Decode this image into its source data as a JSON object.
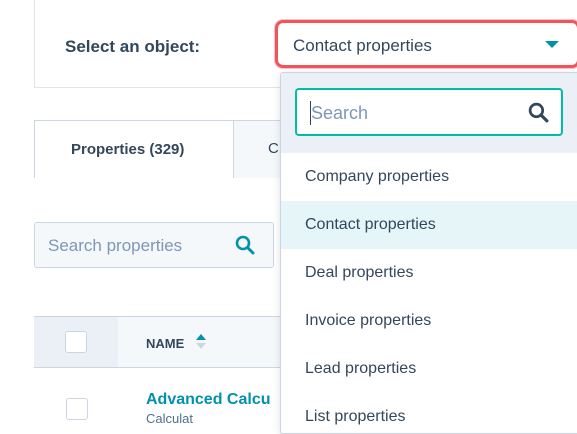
{
  "header": {
    "select_label": "Select an object:",
    "select_value": "Contact properties"
  },
  "tabs": [
    {
      "label": "Properties (329)",
      "active": true
    },
    {
      "label": "C",
      "active": false
    }
  ],
  "search": {
    "placeholder": "Search properties"
  },
  "table": {
    "columns": [
      "NAME"
    ],
    "rows": [
      {
        "name": "Advanced Calcu",
        "sub": "Calculat"
      }
    ]
  },
  "dropdown": {
    "search_placeholder": "Search",
    "options": [
      {
        "label": "Company properties",
        "selected": false
      },
      {
        "label": "Contact properties",
        "selected": true
      },
      {
        "label": "Deal properties",
        "selected": false
      },
      {
        "label": "Invoice properties",
        "selected": false
      },
      {
        "label": "Lead properties",
        "selected": false
      },
      {
        "label": "List properties",
        "selected": false
      }
    ]
  },
  "colors": {
    "accent": "#0091ae",
    "highlight_border": "#f2545b",
    "search_focus": "#00bda5",
    "text": "#33475b"
  }
}
